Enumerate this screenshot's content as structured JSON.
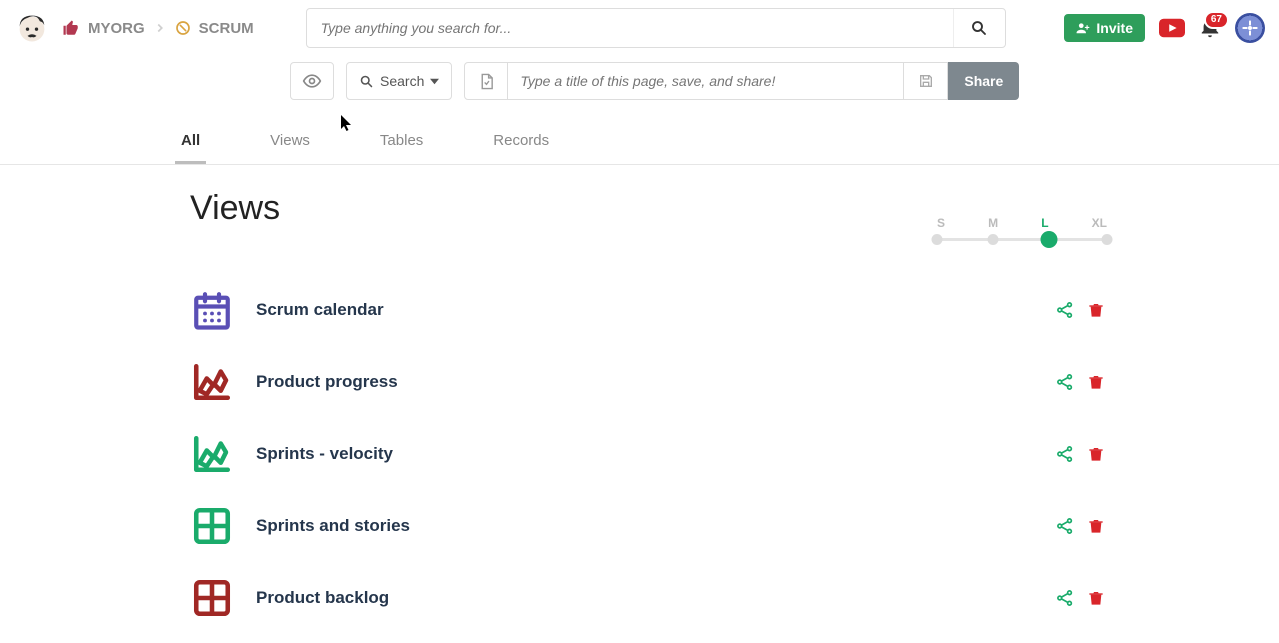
{
  "breadcrumb": {
    "org": "MYORG",
    "project": "SCRUM"
  },
  "search": {
    "placeholder": "Type anything you search for..."
  },
  "toolbar": {
    "search_label": "Search",
    "title_placeholder": "Type a title of this page, save, and share!",
    "share_label": "Share"
  },
  "header": {
    "invite_label": "Invite",
    "notification_count": "67"
  },
  "tabs": [
    "All",
    "Views",
    "Tables",
    "Records"
  ],
  "active_tab": 0,
  "section": {
    "title": "Views"
  },
  "size_options": [
    "S",
    "M",
    "L",
    "XL"
  ],
  "size_active": 2,
  "views": [
    {
      "name": "Scrum calendar",
      "icon": "calendar",
      "color": "#5a4fb5"
    },
    {
      "name": "Product progress",
      "icon": "chart",
      "color": "#a02825"
    },
    {
      "name": "Sprints - velocity",
      "icon": "chart",
      "color": "#1aab6b"
    },
    {
      "name": "Sprints and stories",
      "icon": "grid",
      "color": "#1aab6b"
    },
    {
      "name": "Product backlog",
      "icon": "grid",
      "color": "#a02825"
    }
  ]
}
